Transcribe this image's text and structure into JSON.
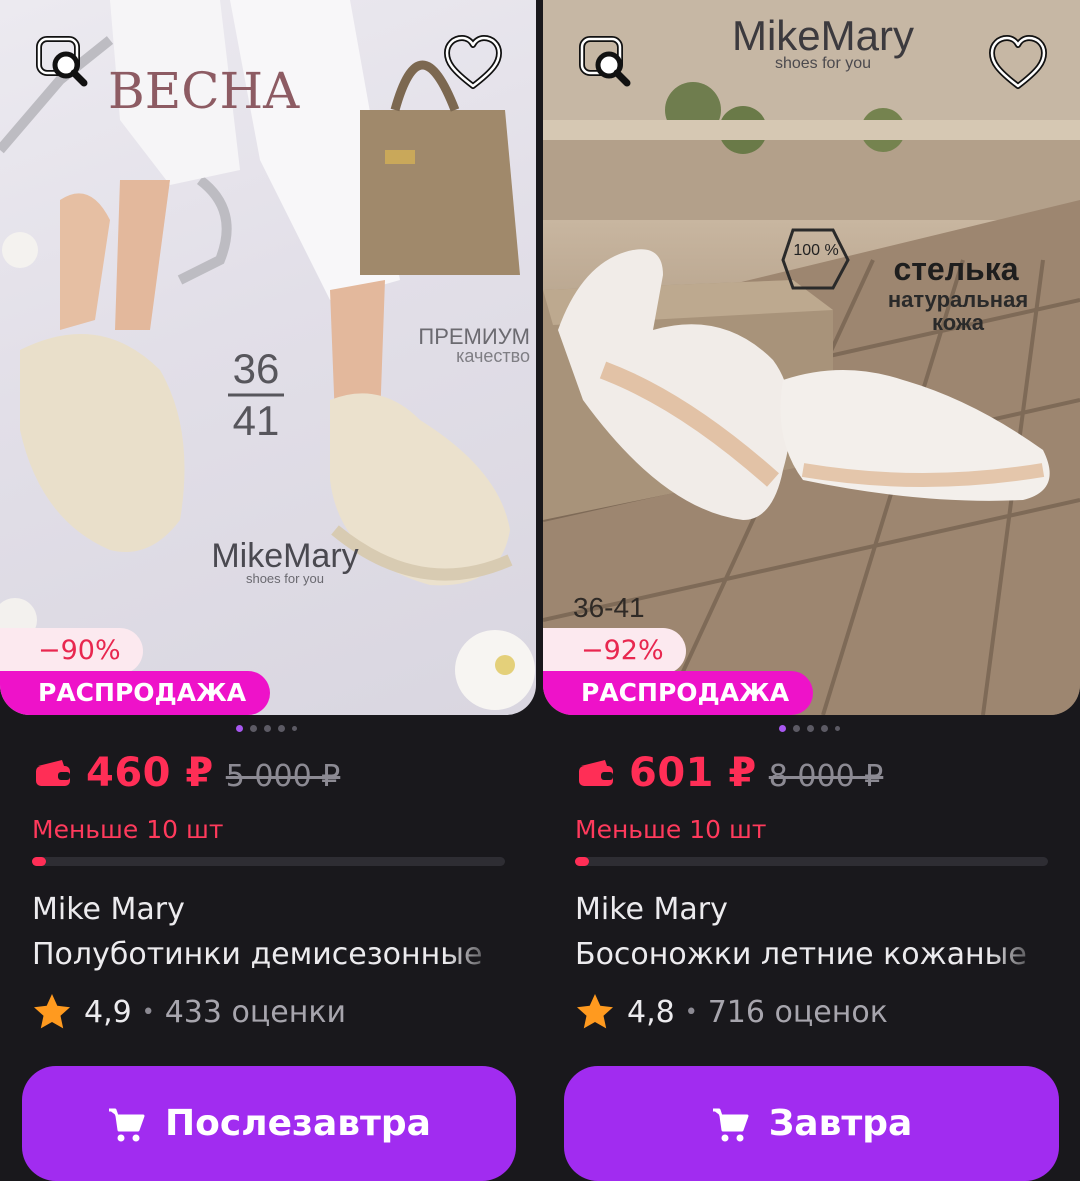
{
  "products": [
    {
      "photo_text": {
        "brand_top": "BECHA",
        "quality": "ПРЕМИУМ",
        "quality_sub": "качество",
        "size_top": "36",
        "size_bottom": "41",
        "logo": "MikeMary",
        "logo_sub": "shoes for you"
      },
      "discount": "−90%",
      "sale_label": "РАСПРОДАЖА",
      "price": "460 ₽",
      "old_price": "5 000 ₽",
      "stock": "Меньше 10 шт",
      "stock_level": 0.03,
      "brand": "Mike Mary",
      "title": "Полуботинки демисезонные",
      "rating": "4,9",
      "reviews": "433 оценки",
      "cta": "Послезавтра"
    },
    {
      "photo_text": {
        "logo": "MikeMary",
        "logo_sub": "shoes for you",
        "stamp": "100 %",
        "line1": "стелька",
        "line2": "натуральная",
        "line3": "кожа",
        "sizes": "36-41"
      },
      "discount": "−92%",
      "sale_label": "РАСПРОДАЖА",
      "price": "601 ₽",
      "old_price": "8 000 ₽",
      "stock": "Меньше 10 шт",
      "stock_level": 0.03,
      "brand": "Mike Mary",
      "title": "Босоножки летние кожаные",
      "rating": "4,8",
      "reviews": "716 оценок",
      "cta": "Завтра"
    }
  ],
  "colors": {
    "background": "#19181c",
    "price": "#ff2e56",
    "sale_badge": "#ee12c9",
    "cta": "#a12cf0",
    "star": "#ff9a1f"
  },
  "icons": [
    "image-search-icon",
    "heart-icon",
    "wallet-icon",
    "star-icon",
    "cart-icon"
  ]
}
